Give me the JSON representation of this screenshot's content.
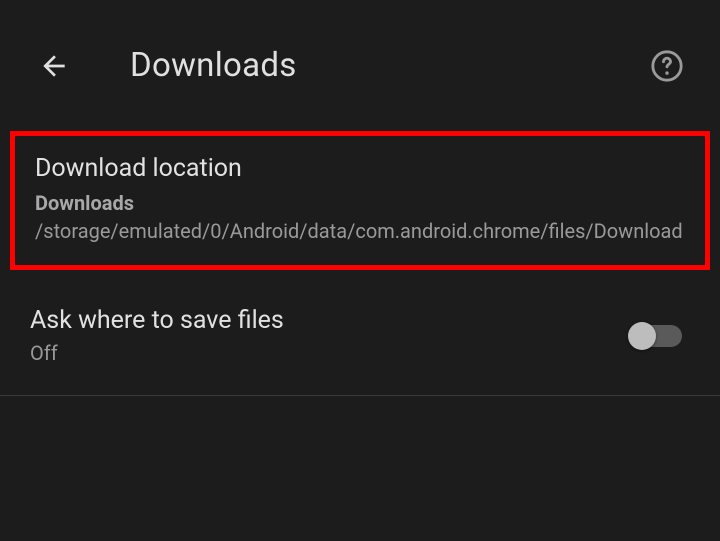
{
  "header": {
    "title": "Downloads"
  },
  "settings": {
    "downloadLocation": {
      "title": "Download location",
      "folderLabel": "Downloads",
      "path": " /storage/emulated/0/Android/data/com.android.chrome/files/Download"
    },
    "askSave": {
      "title": "Ask where to save files",
      "status": "Off",
      "enabled": false
    }
  }
}
